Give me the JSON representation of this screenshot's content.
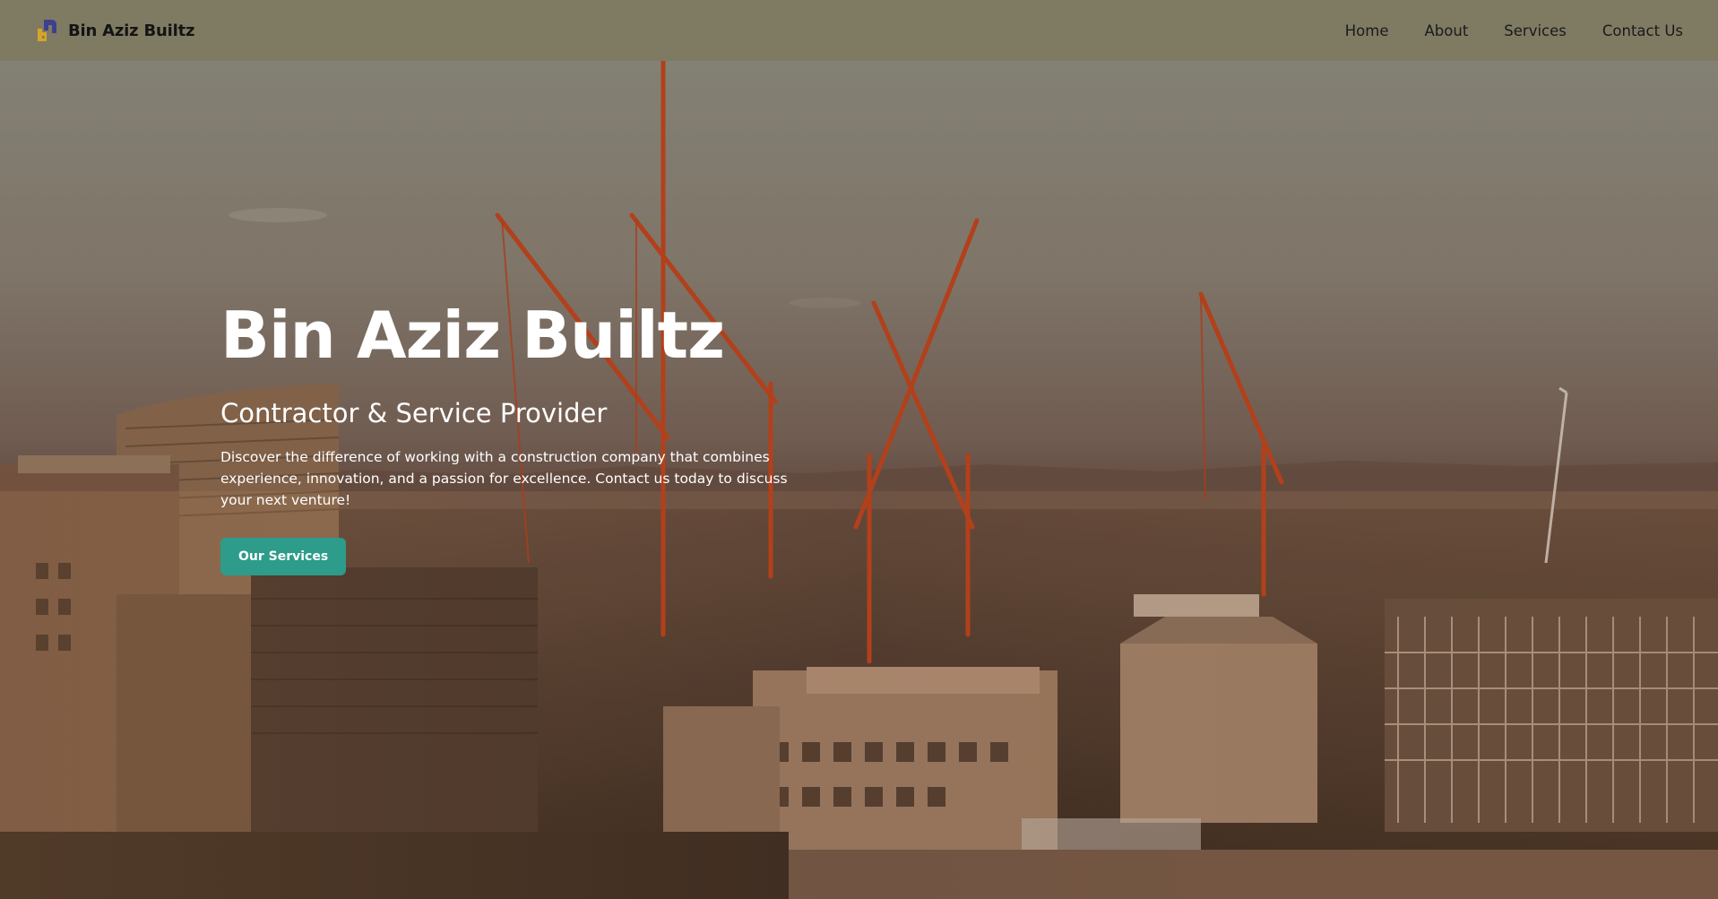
{
  "nav": {
    "brand_name": "Bin Aziz Builtz",
    "links": [
      "Home",
      "About",
      "Services",
      "Contact Us"
    ]
  },
  "hero": {
    "title": "Bin Aziz Builtz",
    "subtitle": "Contractor & Service Provider",
    "description": "Discover the difference of working with a construction company that combines experience, innovation, and a passion for excellence. Contact us today to discuss your next venture!",
    "cta_label": "Our Services"
  },
  "colors": {
    "nav_background": "#7f7b63",
    "cta_background": "#2e9c8a",
    "crane": "#c2461e",
    "logo_blue": "#3e3f8f",
    "logo_gold": "#d4a52a"
  }
}
